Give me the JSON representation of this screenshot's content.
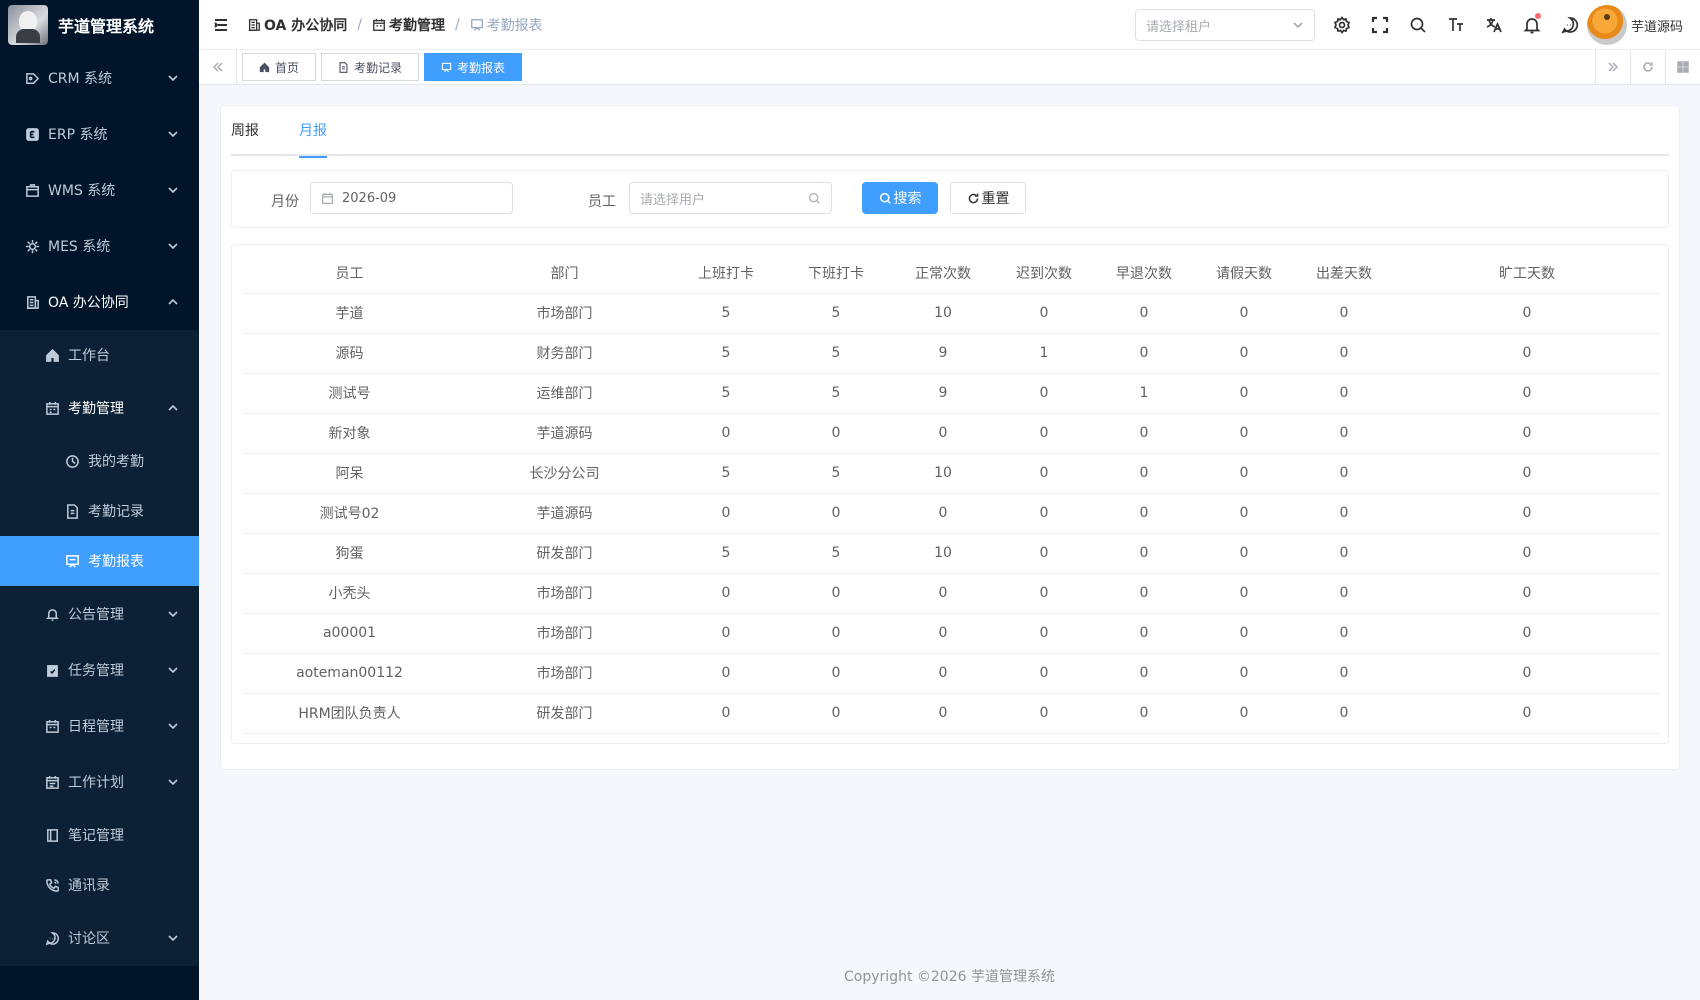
{
  "app": {
    "title": "芋道管理系统"
  },
  "sidebar": {
    "top_items": [
      {
        "label": "CRM 系统",
        "icon": "crm-icon"
      },
      {
        "label": "ERP 系统",
        "icon": "erp-icon"
      },
      {
        "label": "WMS 系统",
        "icon": "wms-icon"
      },
      {
        "label": "MES 系统",
        "icon": "mes-icon"
      },
      {
        "label": "OA 办公协同",
        "icon": "oa-icon"
      }
    ],
    "oa_children": {
      "workbench": "工作台",
      "attendance": "考勤管理",
      "my_attendance": "我的考勤",
      "attendance_records": "考勤记录",
      "attendance_report": "考勤报表",
      "notice": "公告管理",
      "task": "任务管理",
      "schedule": "日程管理",
      "work_plan": "工作计划",
      "notes": "笔记管理",
      "contacts": "通讯录",
      "discussion": "讨论区"
    }
  },
  "header": {
    "breadcrumb": [
      "OA 办公协同",
      "考勤管理",
      "考勤报表"
    ],
    "tenant_placeholder": "请选择租户",
    "username": "芋道源码"
  },
  "tags": [
    "首页",
    "考勤记录",
    "考勤报表"
  ],
  "tabs": [
    "周报",
    "月报"
  ],
  "filter": {
    "month_label": "月份",
    "month_value": "2026-09",
    "employee_label": "员工",
    "employee_placeholder": "请选择用户",
    "search_button": "搜索",
    "reset_button": "重置"
  },
  "table": {
    "columns": [
      "员工",
      "部门",
      "上班打卡",
      "下班打卡",
      "正常次数",
      "迟到次数",
      "早退次数",
      "请假天数",
      "出差天数",
      "旷工天数"
    ],
    "rows": [
      [
        "芋道",
        "市场部门",
        "5",
        "5",
        "10",
        "0",
        "0",
        "0",
        "0",
        "0"
      ],
      [
        "源码",
        "财务部门",
        "5",
        "5",
        "9",
        "1",
        "0",
        "0",
        "0",
        "0"
      ],
      [
        "测试号",
        "运维部门",
        "5",
        "5",
        "9",
        "0",
        "1",
        "0",
        "0",
        "0"
      ],
      [
        "新对象",
        "芋道源码",
        "0",
        "0",
        "0",
        "0",
        "0",
        "0",
        "0",
        "0"
      ],
      [
        "阿呆",
        "长沙分公司",
        "5",
        "5",
        "10",
        "0",
        "0",
        "0",
        "0",
        "0"
      ],
      [
        "测试号02",
        "芋道源码",
        "0",
        "0",
        "0",
        "0",
        "0",
        "0",
        "0",
        "0"
      ],
      [
        "狗蛋",
        "研发部门",
        "5",
        "5",
        "10",
        "0",
        "0",
        "0",
        "0",
        "0"
      ],
      [
        "小秃头",
        "市场部门",
        "0",
        "0",
        "0",
        "0",
        "0",
        "0",
        "0",
        "0"
      ],
      [
        "a00001",
        "市场部门",
        "0",
        "0",
        "0",
        "0",
        "0",
        "0",
        "0",
        "0"
      ],
      [
        "aoteman00112",
        "市场部门",
        "0",
        "0",
        "0",
        "0",
        "0",
        "0",
        "0",
        "0"
      ],
      [
        "HRM团队负责人",
        "研发部门",
        "0",
        "0",
        "0",
        "0",
        "0",
        "0",
        "0",
        "0"
      ]
    ]
  },
  "footer": {
    "copyright": "Copyright ©2026 芋道管理系统"
  },
  "colors": {
    "accent": "#409eff",
    "sidebar_bg": "#001529"
  }
}
